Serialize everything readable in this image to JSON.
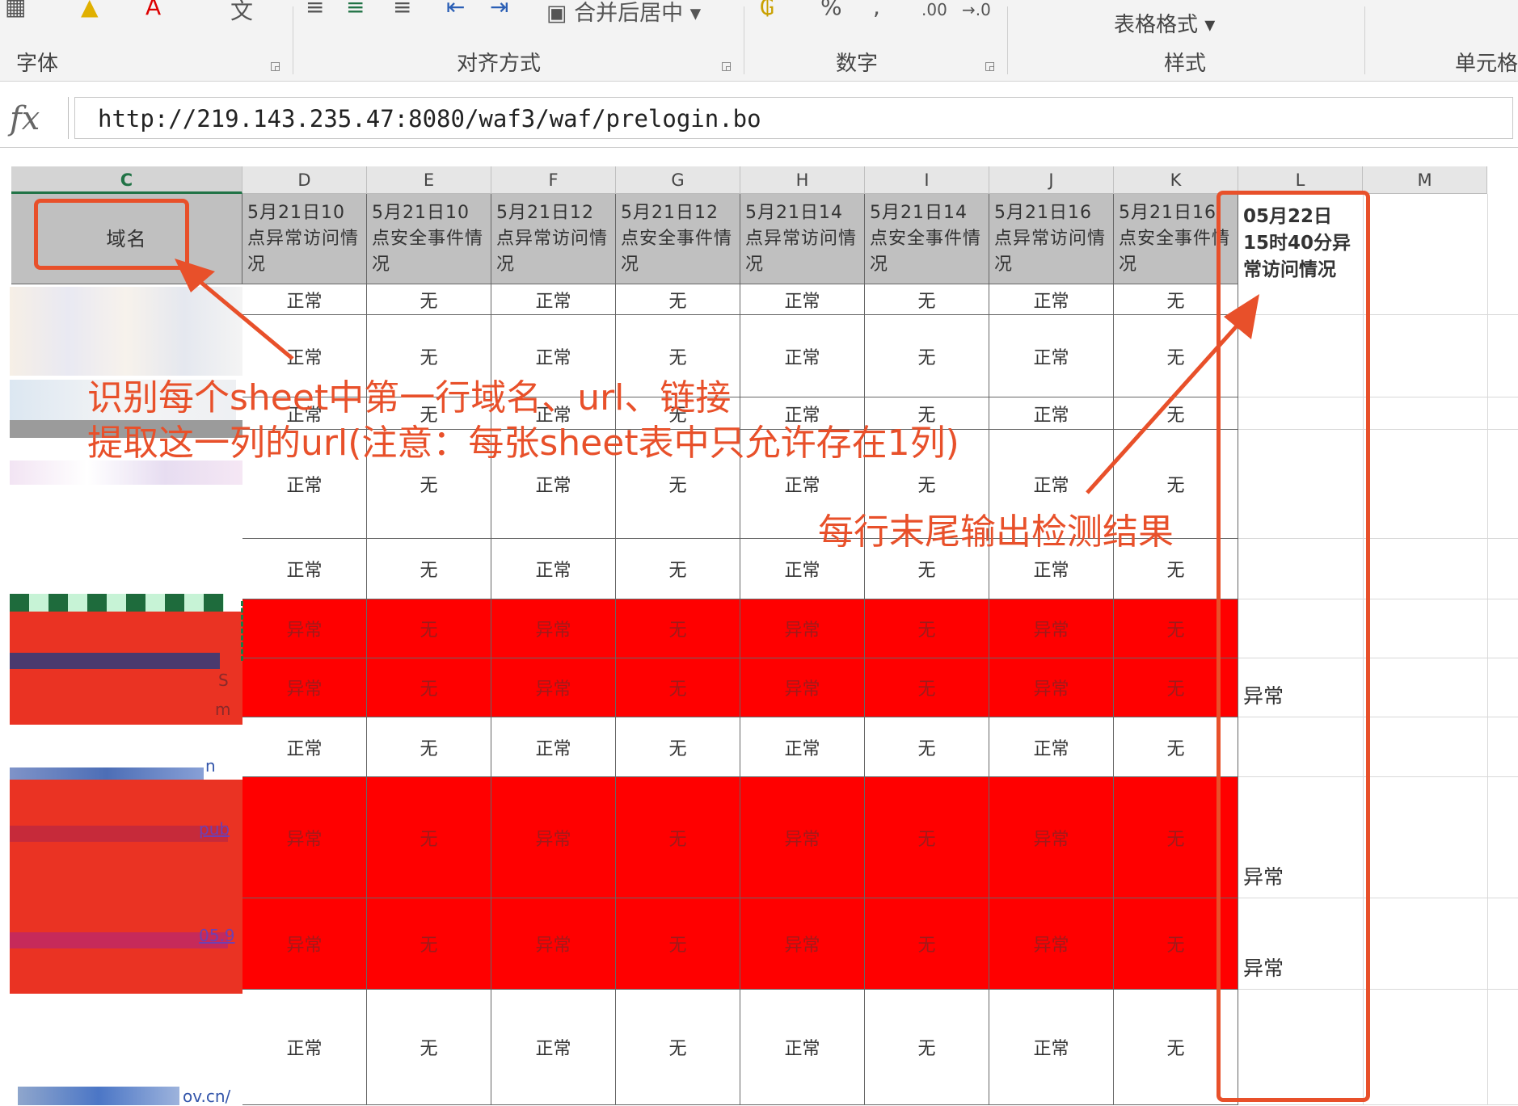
{
  "ribbon": {
    "groups": [
      {
        "label": "字体"
      },
      {
        "label": "对齐方式"
      },
      {
        "label": "数字"
      },
      {
        "label": "样式"
      },
      {
        "label": "单元格"
      }
    ],
    "merge_center": "合并后居中",
    "table_format": "表格格式",
    "percent_symbol": "%",
    "decimal_increase": ".00",
    "decimal_decrease": "→.0"
  },
  "formula_bar": {
    "fx_label": "fx",
    "value": "http://219.143.235.47:8080/waf3/waf/prelogin.bo"
  },
  "columns": [
    "C",
    "D",
    "E",
    "F",
    "G",
    "H",
    "I",
    "J",
    "K",
    "L",
    "M"
  ],
  "header_row": {
    "c": "域名",
    "d": "5月21日10点异常访问情况",
    "e": "5月21日10点安全事件情况",
    "f": "5月21日12点异常访问情况",
    "g": "5月21日12点安全事件情况",
    "h": "5月21日14点异常访问情况",
    "i": "5月21日14点安全事件情况",
    "j": "5月21日16点异常访问情况",
    "k": "5月21日16点安全事件情况",
    "l": "05月22日15时40分异常访问情况"
  },
  "rows": [
    {
      "status": "正常",
      "event": "无",
      "red": false,
      "result": ""
    },
    {
      "status": "正常",
      "event": "无",
      "red": false,
      "result": ""
    },
    {
      "status": "正常",
      "event": "无",
      "red": false,
      "result": ""
    },
    {
      "status": "正常",
      "event": "无",
      "red": false,
      "result": ""
    },
    {
      "status": "正常",
      "event": "无",
      "red": false,
      "result": ""
    },
    {
      "status": "异常",
      "event": "无",
      "red": true,
      "result": ""
    },
    {
      "status": "异常",
      "event": "无",
      "red": true,
      "result": "异常"
    },
    {
      "status": "正常",
      "event": "无",
      "red": false,
      "result": ""
    },
    {
      "status": "异常",
      "event": "无",
      "red": true,
      "result": "异常"
    },
    {
      "status": "异常",
      "event": "无",
      "red": true,
      "result": "异常"
    },
    {
      "status": "正常",
      "event": "无",
      "red": false,
      "result": ""
    }
  ],
  "visible_link_fragments": [
    "n",
    "pub",
    "05.9",
    "ov.cn/",
    "S",
    "m"
  ],
  "annotations": {
    "line1": "识别每个sheet中第一行域名、url、链接",
    "line2": "提取这一列的url(注意：每张sheet表中只允许存在1列)",
    "line3": "每行末尾输出检测结果"
  },
  "colors": {
    "annotation": "#e8502a",
    "highlight_row": "#ff0000",
    "header_fill": "#c0c0c0",
    "excel_green": "#217346"
  }
}
